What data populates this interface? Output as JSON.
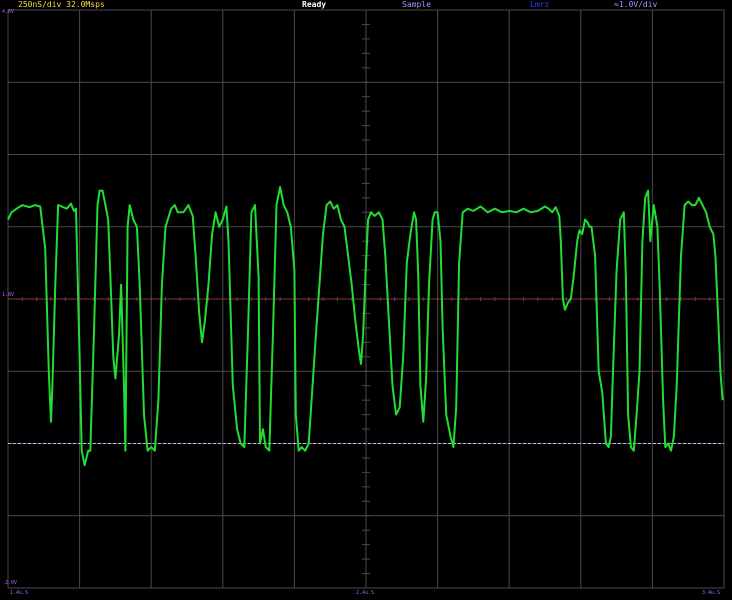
{
  "status_bar": {
    "timebase": "250nS/div 32.0Msps",
    "state": "Ready",
    "acquisition": "Sample",
    "mode": "Lmrz",
    "volts_per_div": "≈1.0V/div"
  },
  "colors": {
    "background": "#000000",
    "grid": "#4a4a4a",
    "trace": "#22dd33",
    "reference_line": "#cc2222",
    "lower_reference": "#bbbbff",
    "timebase_text": "#ffdd44",
    "state_text": "#ffffff",
    "acquisition_text": "#9999ff",
    "mode_text": "#2244ff",
    "volts_text": "#9999ff"
  },
  "markers": {
    "top_left": "4.0V",
    "mid_left": "1.0V",
    "bottom_left": "-2.0V",
    "bottom_time_left": "1.4u.S",
    "bottom_time_mid": "2.4u.S",
    "bottom_time_right": "3.4u.S"
  },
  "chart_data": {
    "type": "line",
    "grid": true,
    "x_divisions": 10,
    "y_divisions": 8,
    "y_unit_per_div": 1.0,
    "ylim": [
      -4,
      4
    ],
    "xlim": [
      0,
      10
    ],
    "reference_levels": [
      0,
      -2
    ],
    "series": [
      {
        "values_xy": [
          [
            0,
            1.1
          ],
          [
            0.05,
            1.2
          ],
          [
            0.12,
            1.25
          ],
          [
            0.2,
            1.3
          ],
          [
            0.3,
            1.27
          ],
          [
            0.38,
            1.3
          ],
          [
            0.45,
            1.28
          ],
          [
            0.52,
            0.7
          ],
          [
            0.57,
            -1.0
          ],
          [
            0.6,
            -1.7
          ],
          [
            0.62,
            -1.2
          ],
          [
            0.66,
            0.2
          ],
          [
            0.7,
            1.3
          ],
          [
            0.75,
            1.28
          ],
          [
            0.82,
            1.25
          ],
          [
            0.88,
            1.32
          ],
          [
            0.92,
            1.22
          ],
          [
            0.95,
            1.25
          ],
          [
            1.0,
            -0.8
          ],
          [
            1.03,
            -2.1
          ],
          [
            1.07,
            -2.3
          ],
          [
            1.12,
            -2.1
          ],
          [
            1.15,
            -2.1
          ],
          [
            1.2,
            -0.5
          ],
          [
            1.25,
            1.3
          ],
          [
            1.28,
            1.5
          ],
          [
            1.32,
            1.5
          ],
          [
            1.36,
            1.3
          ],
          [
            1.4,
            1.1
          ],
          [
            1.43,
            0.3
          ],
          [
            1.47,
            -0.8
          ],
          [
            1.5,
            -1.1
          ],
          [
            1.55,
            -0.5
          ],
          [
            1.58,
            0.2
          ],
          [
            1.62,
            -1.2
          ],
          [
            1.64,
            -2.1
          ],
          [
            1.67,
            1.0
          ],
          [
            1.7,
            1.3
          ],
          [
            1.75,
            1.1
          ],
          [
            1.8,
            1.0
          ],
          [
            1.84,
            0.2
          ],
          [
            1.9,
            -1.6
          ],
          [
            1.95,
            -2.1
          ],
          [
            2.0,
            -2.05
          ],
          [
            2.05,
            -2.1
          ],
          [
            2.1,
            -1.4
          ],
          [
            2.15,
            0.2
          ],
          [
            2.2,
            1.0
          ],
          [
            2.28,
            1.25
          ],
          [
            2.33,
            1.3
          ],
          [
            2.37,
            1.2
          ],
          [
            2.45,
            1.2
          ],
          [
            2.52,
            1.3
          ],
          [
            2.58,
            1.15
          ],
          [
            2.62,
            0.6
          ],
          [
            2.67,
            -0.2
          ],
          [
            2.71,
            -0.6
          ],
          [
            2.75,
            -0.3
          ],
          [
            2.8,
            0.2
          ],
          [
            2.85,
            0.9
          ],
          [
            2.9,
            1.2
          ],
          [
            2.95,
            1.0
          ],
          [
            3.0,
            1.1
          ],
          [
            3.05,
            1.28
          ],
          [
            3.08,
            0.8
          ],
          [
            3.14,
            -1.2
          ],
          [
            3.2,
            -1.8
          ],
          [
            3.25,
            -2.0
          ],
          [
            3.3,
            -2.05
          ],
          [
            3.35,
            -0.5
          ],
          [
            3.4,
            1.2
          ],
          [
            3.45,
            1.3
          ],
          [
            3.5,
            0.3
          ],
          [
            3.52,
            -2.0
          ],
          [
            3.56,
            -1.8
          ],
          [
            3.6,
            -2.05
          ],
          [
            3.65,
            -2.1
          ],
          [
            3.7,
            -0.5
          ],
          [
            3.75,
            1.3
          ],
          [
            3.8,
            1.55
          ],
          [
            3.85,
            1.3
          ],
          [
            3.9,
            1.2
          ],
          [
            3.95,
            1.0
          ],
          [
            4.0,
            0.4
          ],
          [
            4.02,
            -1.6
          ],
          [
            4.06,
            -2.1
          ],
          [
            4.1,
            -2.05
          ],
          [
            4.15,
            -2.1
          ],
          [
            4.2,
            -2.0
          ],
          [
            4.3,
            -0.5
          ],
          [
            4.4,
            0.9
          ],
          [
            4.45,
            1.3
          ],
          [
            4.5,
            1.35
          ],
          [
            4.55,
            1.25
          ],
          [
            4.6,
            1.3
          ],
          [
            4.65,
            1.1
          ],
          [
            4.7,
            1.0
          ],
          [
            4.75,
            0.6
          ],
          [
            4.8,
            0.2
          ],
          [
            4.85,
            -0.3
          ],
          [
            4.9,
            -0.7
          ],
          [
            4.93,
            -0.9
          ],
          [
            4.96,
            -0.5
          ],
          [
            5.0,
            0.5
          ],
          [
            5.03,
            1.1
          ],
          [
            5.07,
            1.2
          ],
          [
            5.12,
            1.15
          ],
          [
            5.18,
            1.2
          ],
          [
            5.23,
            1.1
          ],
          [
            5.27,
            0.6
          ],
          [
            5.32,
            -0.3
          ],
          [
            5.37,
            -1.2
          ],
          [
            5.42,
            -1.6
          ],
          [
            5.47,
            -1.5
          ],
          [
            5.52,
            -0.8
          ],
          [
            5.57,
            0.5
          ],
          [
            5.62,
            0.9
          ],
          [
            5.67,
            1.2
          ],
          [
            5.7,
            1.1
          ],
          [
            5.73,
            0.3
          ],
          [
            5.76,
            -1.2
          ],
          [
            5.8,
            -1.7
          ],
          [
            5.84,
            -1.1
          ],
          [
            5.88,
            0.2
          ],
          [
            5.93,
            1.1
          ],
          [
            5.96,
            1.2
          ],
          [
            6.0,
            1.2
          ],
          [
            6.04,
            0.8
          ],
          [
            6.07,
            -0.4
          ],
          [
            6.12,
            -1.6
          ],
          [
            6.18,
            -1.9
          ],
          [
            6.22,
            -2.05
          ],
          [
            6.26,
            -1.5
          ],
          [
            6.3,
            0.5
          ],
          [
            6.35,
            1.2
          ],
          [
            6.42,
            1.25
          ],
          [
            6.5,
            1.22
          ],
          [
            6.6,
            1.28
          ],
          [
            6.7,
            1.2
          ],
          [
            6.8,
            1.25
          ],
          [
            6.9,
            1.2
          ],
          [
            7.0,
            1.22
          ],
          [
            7.1,
            1.2
          ],
          [
            7.2,
            1.25
          ],
          [
            7.3,
            1.2
          ],
          [
            7.4,
            1.22
          ],
          [
            7.5,
            1.28
          ],
          [
            7.55,
            1.25
          ],
          [
            7.6,
            1.2
          ],
          [
            7.65,
            1.27
          ],
          [
            7.7,
            1.15
          ],
          [
            7.72,
            0.8
          ],
          [
            7.75,
            0.0
          ],
          [
            7.78,
            -0.15
          ],
          [
            7.82,
            -0.05
          ],
          [
            7.86,
            0.0
          ],
          [
            7.9,
            0.3
          ],
          [
            7.95,
            0.8
          ],
          [
            7.98,
            0.95
          ],
          [
            8.02,
            0.9
          ],
          [
            8.06,
            1.1
          ],
          [
            8.1,
            1.05
          ],
          [
            8.12,
            1.0
          ],
          [
            8.15,
            1.0
          ],
          [
            8.2,
            0.6
          ],
          [
            8.25,
            -1.0
          ],
          [
            8.3,
            -1.3
          ],
          [
            8.35,
            -2.0
          ],
          [
            8.39,
            -2.05
          ],
          [
            8.42,
            -1.9
          ],
          [
            8.45,
            -1.0
          ],
          [
            8.5,
            0.4
          ],
          [
            8.55,
            1.1
          ],
          [
            8.6,
            1.2
          ],
          [
            8.63,
            0.3
          ],
          [
            8.66,
            -1.6
          ],
          [
            8.7,
            -2.05
          ],
          [
            8.74,
            -2.1
          ],
          [
            8.78,
            -1.6
          ],
          [
            8.82,
            -1.0
          ],
          [
            8.86,
            0.8
          ],
          [
            8.9,
            1.4
          ],
          [
            8.94,
            1.5
          ],
          [
            8.97,
            0.8
          ],
          [
            9.02,
            1.3
          ],
          [
            9.07,
            1.0
          ],
          [
            9.1,
            0.2
          ],
          [
            9.15,
            -1.4
          ],
          [
            9.18,
            -2.05
          ],
          [
            9.22,
            -2.0
          ],
          [
            9.26,
            -2.1
          ],
          [
            9.3,
            -1.9
          ],
          [
            9.34,
            -1.2
          ],
          [
            9.4,
            0.6
          ],
          [
            9.45,
            1.3
          ],
          [
            9.5,
            1.35
          ],
          [
            9.55,
            1.3
          ],
          [
            9.6,
            1.3
          ],
          [
            9.65,
            1.4
          ],
          [
            9.7,
            1.3
          ],
          [
            9.75,
            1.2
          ],
          [
            9.8,
            1.0
          ],
          [
            9.85,
            0.9
          ],
          [
            9.88,
            0.6
          ],
          [
            9.92,
            -0.3
          ],
          [
            9.95,
            -1.0
          ],
          [
            9.98,
            -1.4
          ]
        ]
      }
    ]
  }
}
